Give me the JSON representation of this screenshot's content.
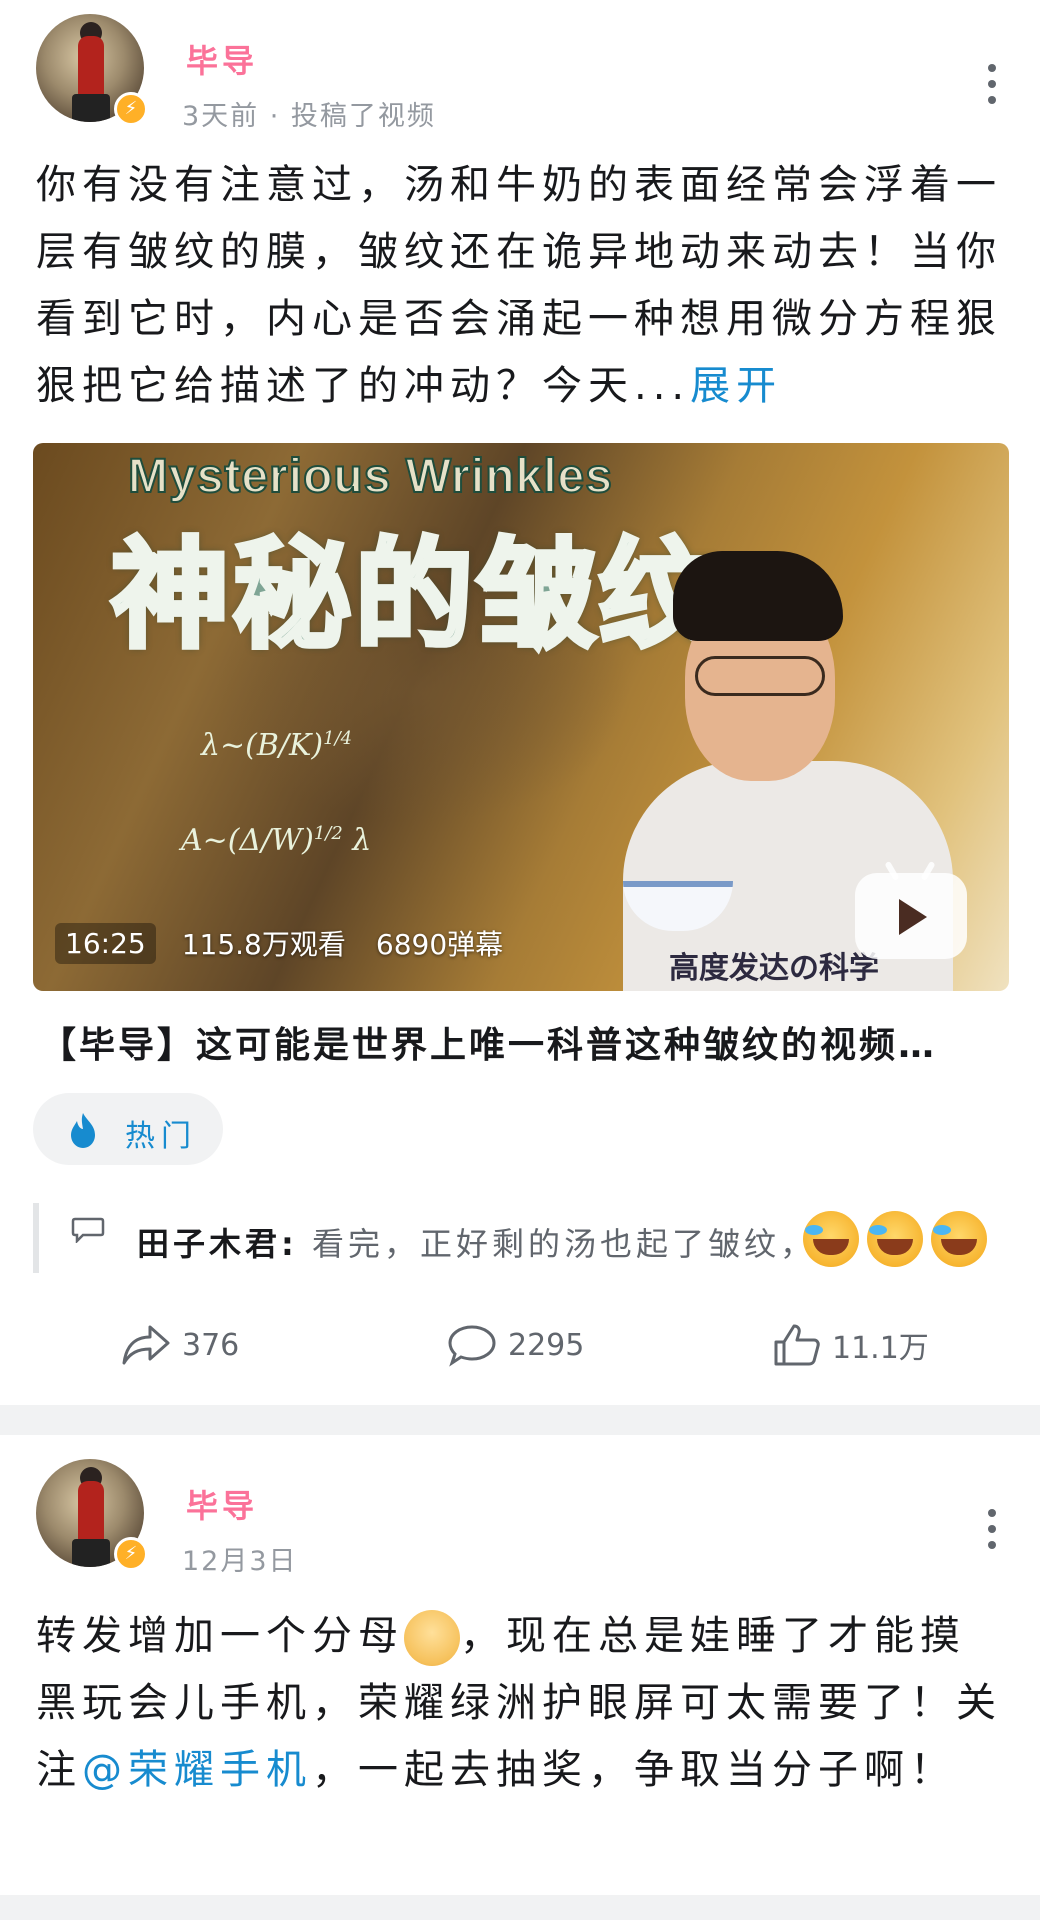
{
  "post1": {
    "author": "毕导",
    "meta": "3天前 · 投稿了视频",
    "text": "你有没有注意过，汤和牛奶的表面经常会浮着一层有皱纹的膜，皱纹还在诡异地动来动去！当你看到它时，内心是否会涌起一种想用微分方程狠狠把它给描述了的冲动？今天...",
    "expand_label": "展开",
    "video": {
      "cover_title_en": "Mysterious Wrinkles",
      "cover_title_zh": "神秘的皱纹",
      "cover_caption": "高度发达の科学",
      "duration": "16:25",
      "views": "115.8万观看",
      "danmaku": "6890弹幕",
      "title": "【毕导】这可能是世界上唯一科普这种皱纹的视频…"
    },
    "tag": {
      "label": "热门",
      "icon": "flame-icon"
    },
    "top_comment": {
      "author": "田子木君:",
      "text": " 看完，正好剩的汤也起了皱纹，"
    },
    "actions": {
      "share": "376",
      "comment": "2295",
      "like": "11.1万"
    }
  },
  "post2": {
    "author": "毕导",
    "meta": "12月3日",
    "text_part1": "转发增加一个分母",
    "text_part2": "，现在总是娃睡了才能摸黑玩会儿手机，荣耀绿洲护眼屏可太需要了！关注",
    "mention": "@荣耀手机",
    "text_part3": "，一起去抽奖，争取当分子啊！"
  },
  "colors": {
    "accent_pink": "#fb7299",
    "link_blue": "#178bcf",
    "muted": "#9499a0"
  }
}
